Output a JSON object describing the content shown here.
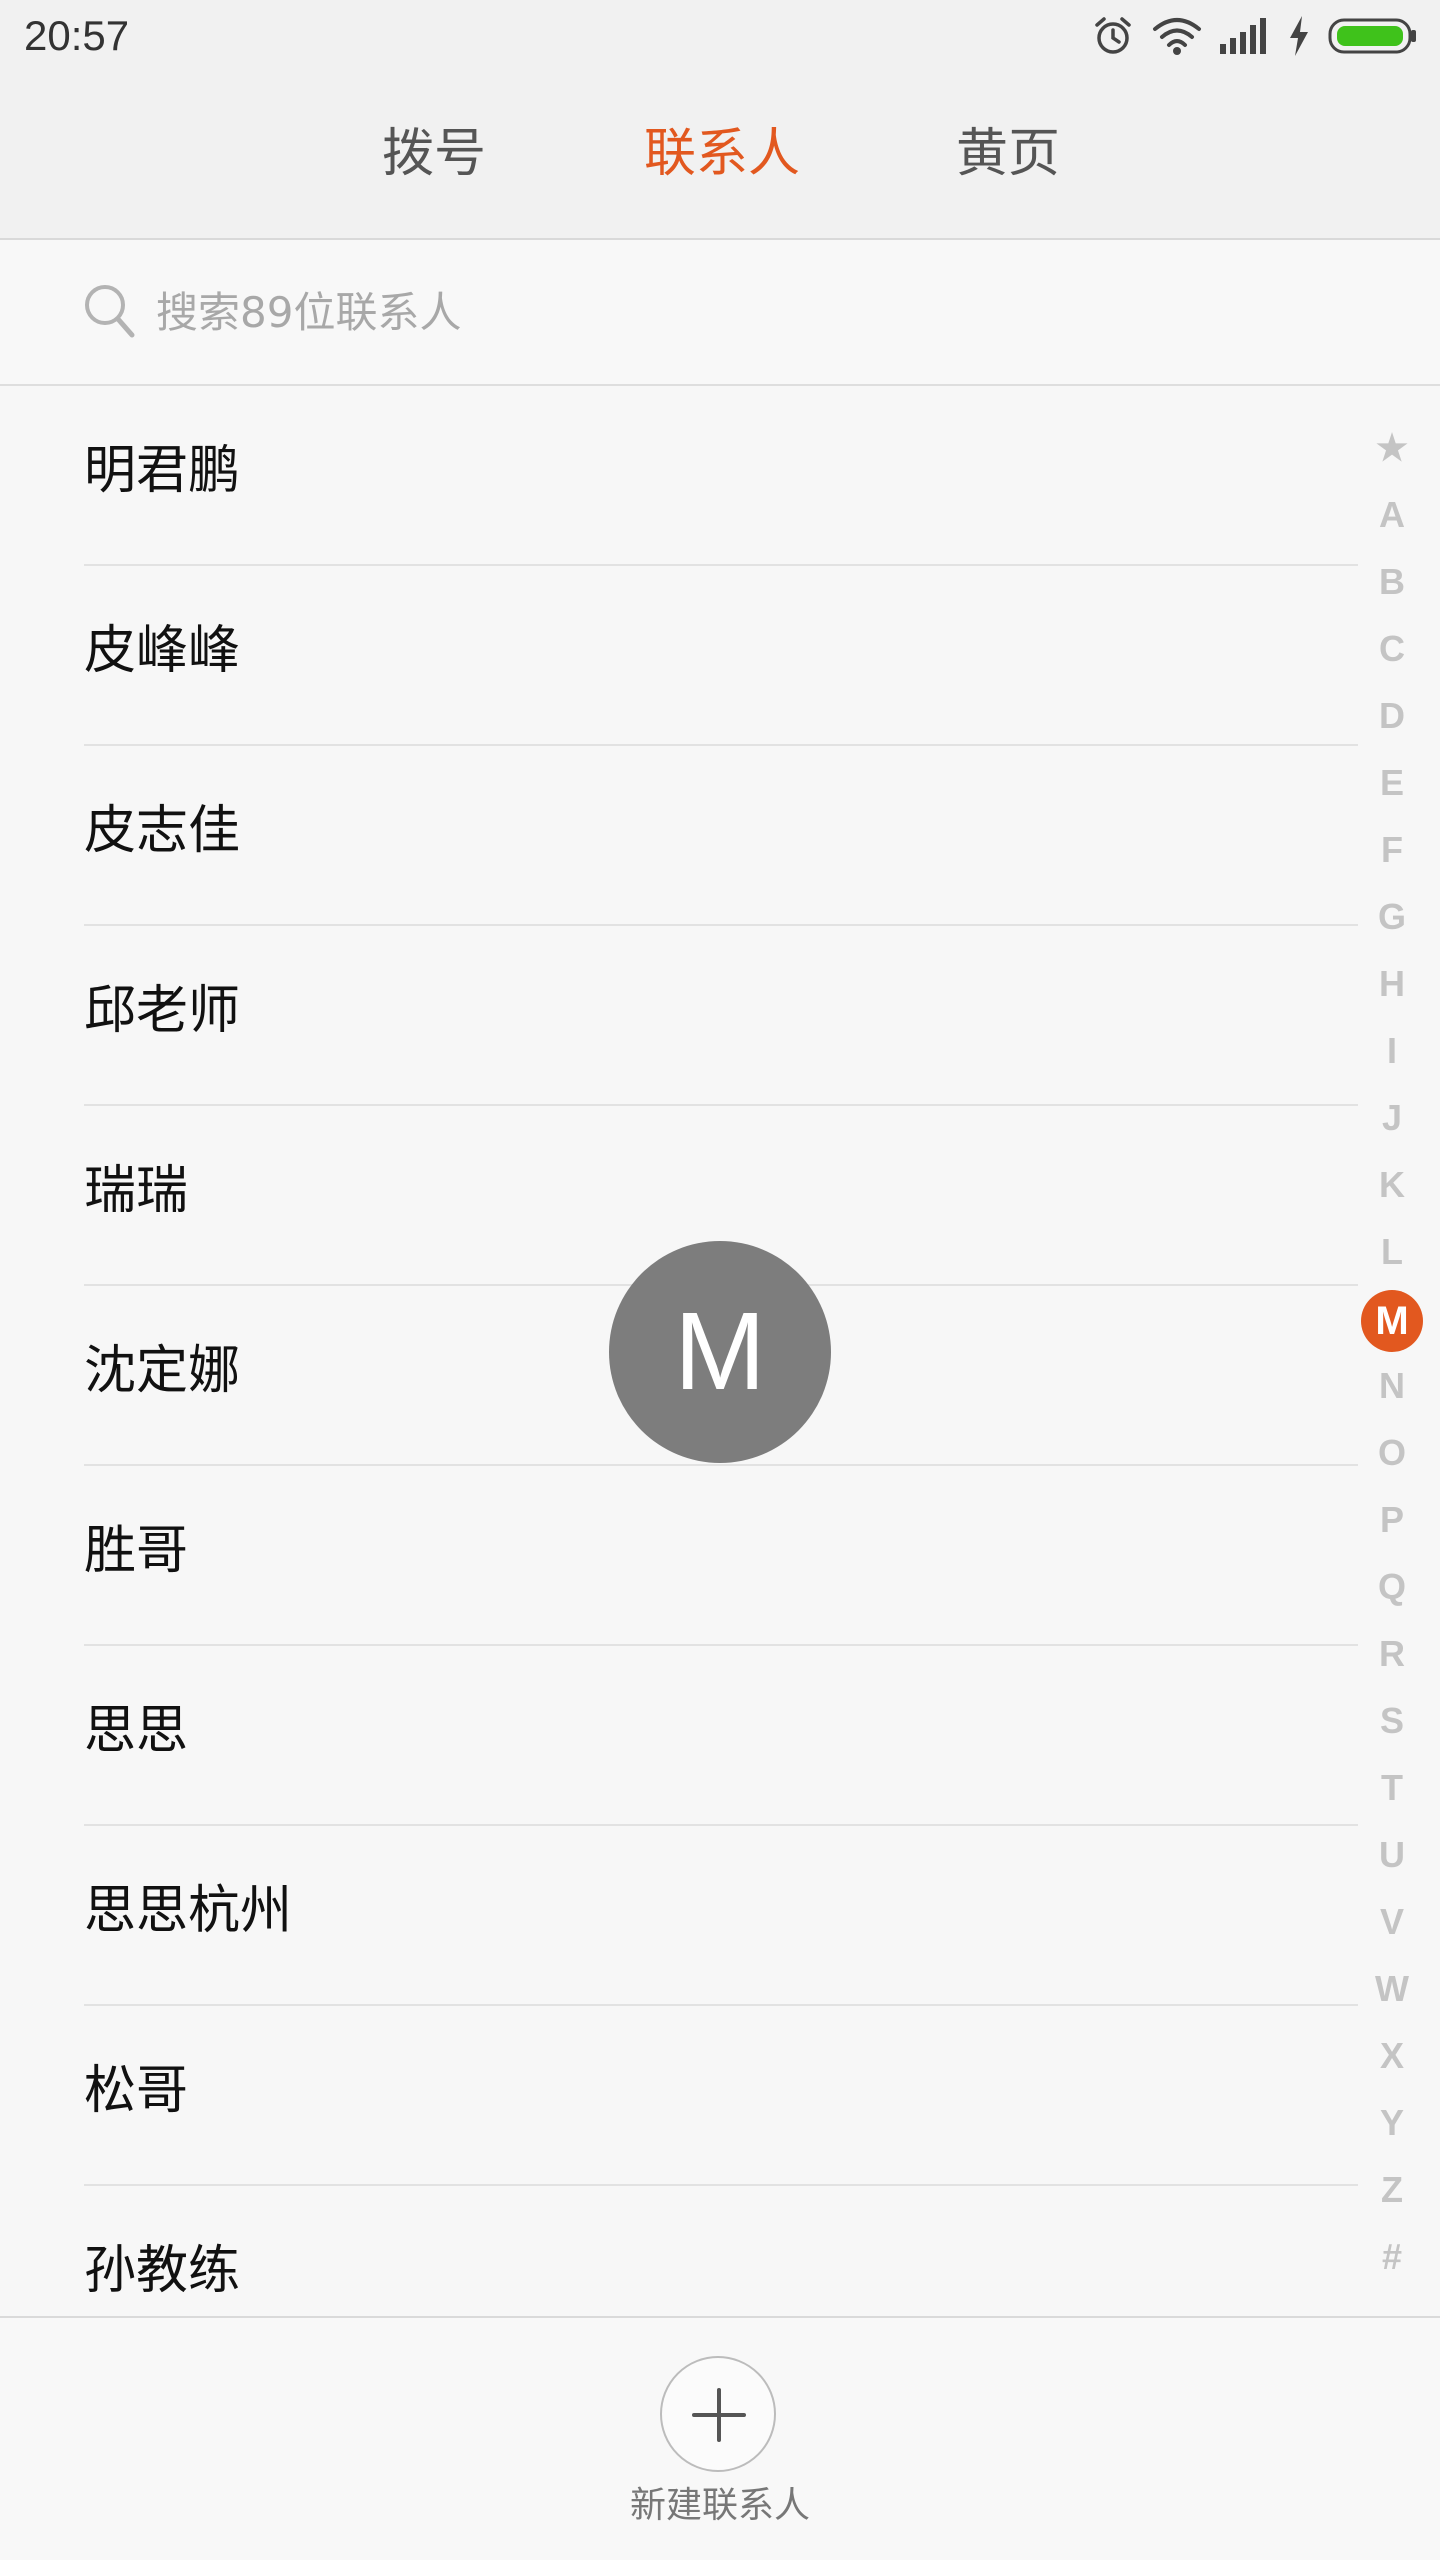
{
  "status_bar": {
    "time": "20:57",
    "icons": [
      "alarm-icon",
      "wifi-icon",
      "signal-icon",
      "charging-icon",
      "battery-icon"
    ],
    "battery_color": "#3fc21b"
  },
  "tabs": [
    {
      "label": "拨号",
      "active": false
    },
    {
      "label": "联系人",
      "active": true
    },
    {
      "label": "黄页",
      "active": false
    }
  ],
  "accent_color": "#e2581f",
  "search": {
    "placeholder": "搜索89位联系人"
  },
  "contacts": [
    "明君鹏",
    "皮峰峰",
    "皮志佳",
    "邱老师",
    "瑞瑞",
    "沈定娜",
    "胜哥",
    "思思",
    "思思杭州",
    "松哥",
    "孙教练"
  ],
  "alphabet_index": {
    "letters": [
      "★",
      "A",
      "B",
      "C",
      "D",
      "E",
      "F",
      "G",
      "H",
      "I",
      "J",
      "K",
      "L",
      "M",
      "N",
      "O",
      "P",
      "Q",
      "R",
      "S",
      "T",
      "U",
      "V",
      "W",
      "X",
      "Y",
      "Z",
      "#"
    ],
    "selected": "M"
  },
  "letter_bubble": "M",
  "bottom_bar": {
    "add_label": "新建联系人"
  }
}
